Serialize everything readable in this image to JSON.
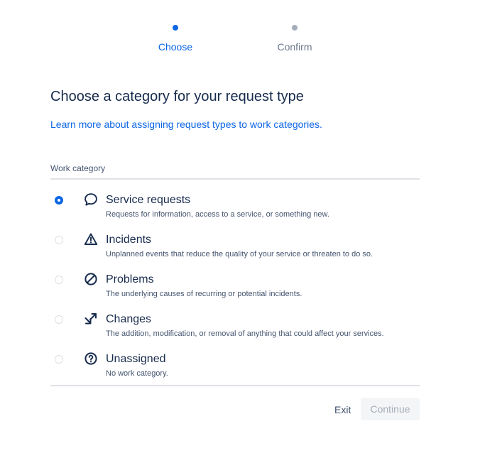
{
  "stepper": {
    "steps": [
      {
        "label": "Choose",
        "state": "active"
      },
      {
        "label": "Confirm",
        "state": "inactive"
      }
    ]
  },
  "heading": {
    "title": "Choose a category for your request type",
    "learn_more": "Learn more about assigning request types to work categories."
  },
  "category": {
    "label": "Work category",
    "selected": "service-requests",
    "options": [
      {
        "id": "service-requests",
        "icon": "speech-bubble-icon",
        "title": "Service requests",
        "description": "Requests for information, access to a service, or something new."
      },
      {
        "id": "incidents",
        "icon": "warning-triangle-icon",
        "title": "Incidents",
        "description": "Unplanned events that reduce the quality of your service or threaten to do so."
      },
      {
        "id": "problems",
        "icon": "prohibited-icon",
        "title": "Problems",
        "description": "The underlying causes of recurring or potential incidents."
      },
      {
        "id": "changes",
        "icon": "swap-arrows-icon",
        "title": "Changes",
        "description": "The addition, modification, or removal of anything that could affect your services."
      },
      {
        "id": "unassigned",
        "icon": "question-circle-icon",
        "title": "Unassigned",
        "description": "No work category."
      }
    ]
  },
  "footer": {
    "exit_label": "Exit",
    "continue_label": "Continue"
  },
  "colors": {
    "primary": "#0c66e4",
    "text": "#172b4d",
    "subtle_text": "#44546f",
    "disabled_bg": "#f4f5f7",
    "disabled_text": "#a5adba"
  }
}
